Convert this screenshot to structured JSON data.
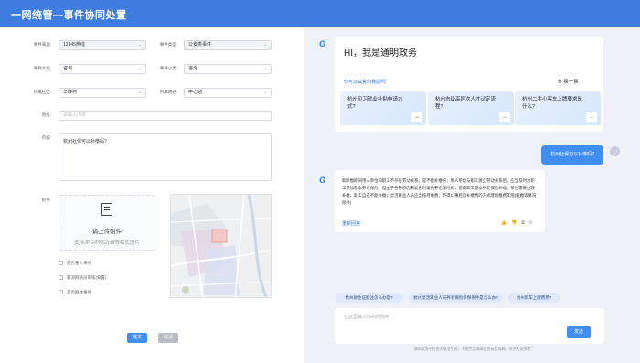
{
  "header": {
    "title": "一网统管—事件协同处置"
  },
  "form": {
    "source_label": "事件来源:",
    "source_value": "12345热线",
    "type_label": "事件类型:",
    "type_value": "公安类事件",
    "category_label": "事件大类:",
    "category_value": "咨询",
    "subcategory_label": "事件小类:",
    "subcategory_value": "咨询",
    "community_label": "所属社区:",
    "community_value": "华联村",
    "grid_label": "所属网格:",
    "grid_value": "中心站",
    "address_label": "地址:",
    "address_placeholder": "请输入内容",
    "content_label": "内容:",
    "content_value": "杭州社保可以补缴吗?",
    "attachment_label": "附件:",
    "upload_title": "请上传附件",
    "upload_hint": "支持JPG/PNG/pdf等格式图片",
    "checkboxes": [
      "是否重大事件",
      "取消网格员审核(处置)",
      "是否群体事件"
    ],
    "submit_label": "提交",
    "cancel_label": "取消"
  },
  "chat": {
    "greeting": "HI，我是通明政务",
    "ask_hint": "你可以试着向我提问:",
    "swap_label": "换一换",
    "suggestions": [
      "杭州见习就业补贴申请方式?",
      "杭州市级高层次人才认定流程?",
      "杭州二手小客车上牌要求是什么?"
    ],
    "user_message": "杭州社保可以补缴吗?",
    "answer": "如断缴期间用人单位和职工不存在劳动关系，是不能补缴的；用人单位与职工建立劳动关系后，应当及时为职工参加基本养老保险，但由于各种原因未能按时缴纳养老保险费，造成职工基本养老保险补缴，单位需要办理补缴，职工自己不能补缴；灵活就业人员应当按月缴费，不得以事后追补缴费的方式增加缴费年限(缓缴等情况除外)",
    "regenerate_label": "重新回答",
    "quick_chips": [
      "杭州居住证能注怎么办理?",
      "杭州灵活就业人员养老保险参保条件是怎么办?",
      "杭州新车上牌费用?"
    ],
    "input_placeholder": "在这里输入你的问题吧",
    "send_label": "发送",
    "footer": "通明政务平台由大模型生成，不能完全保障信息真实准确，仅供大家参考"
  },
  "colors": {
    "header": "#3f7ce0",
    "primary": "#3f8ef0",
    "panel": "#eef1f8"
  }
}
